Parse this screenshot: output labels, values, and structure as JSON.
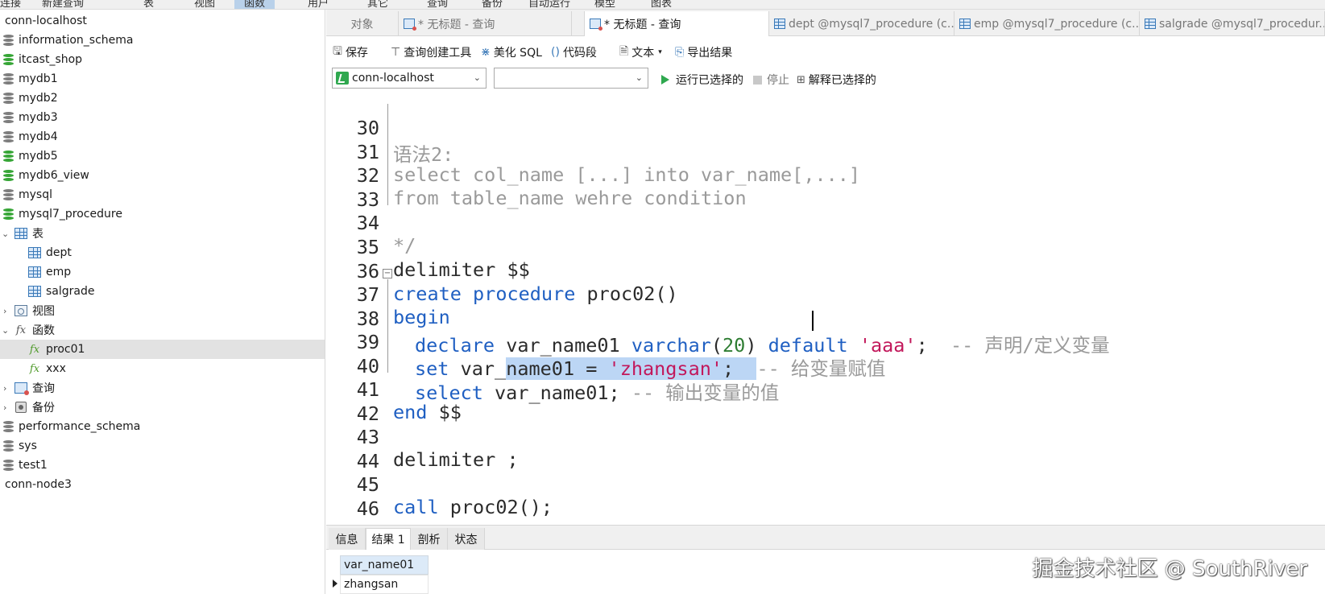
{
  "menu": {
    "items": [
      "连接",
      "新建查询",
      "表",
      "视图",
      "函数",
      "用户",
      "其它",
      "查询",
      "备份",
      "自动运行",
      "模型",
      "图表"
    ],
    "active": "函数"
  },
  "sidebar": {
    "connection": "conn-localhost",
    "databases": {
      "information_schema": "information_schema",
      "itcast_shop": "itcast_shop",
      "mydb1": "mydb1",
      "mydb2": "mydb2",
      "mydb3": "mydb3",
      "mydb4": "mydb4",
      "mydb5": "mydb5",
      "mydb6_view": "mydb6_view",
      "mysql": "mysql",
      "mysql7_procedure": "mysql7_procedure",
      "performance_schema": "performance_schema",
      "sys": "sys",
      "test1": "test1"
    },
    "tables_label": "表",
    "tables": [
      "dept",
      "emp",
      "salgrade"
    ],
    "views_label": "视图",
    "functions_label": "函数",
    "functions": [
      "proc01",
      "xxx"
    ],
    "queries_label": "查询",
    "backups_label": "备份",
    "connection2": "conn-node3"
  },
  "tabs": {
    "objects": "对象",
    "query1": "* 无标题 - 查询",
    "query2": "* 无标题 - 查询",
    "dept": "dept @mysql7_procedure (c...",
    "emp": "emp @mysql7_procedure (c...",
    "salgrade": "salgrade @mysql7_procedur..."
  },
  "toolbar": {
    "save": "保存",
    "query_builder": "查询创建工具",
    "beautify": "美化 SQL",
    "snippet": "代码段",
    "text": "文本",
    "export": "导出结果"
  },
  "toolbar2": {
    "connection_value": "conn-localhost",
    "database_value": "",
    "run_selected": "运行已选择的",
    "stop": "停止",
    "explain_selected": "解释已选择的"
  },
  "editor": {
    "line_numbers": [
      "30",
      "31",
      "32",
      "33",
      "34",
      "35",
      "36",
      "37",
      "38",
      "39",
      "40",
      "41",
      "42",
      "43",
      "44",
      "45",
      "46"
    ],
    "l30": "语法2:",
    "l31": "select col_name [...] into var_name[,...]",
    "l32": "from table_name wehre condition",
    "l34": "*/",
    "l35": "delimiter $$",
    "l36_kw": "create procedure",
    "l36_rest": " proc02()",
    "l37": "begin",
    "l38_kw1": "declare",
    "l38_a": " var_name01 ",
    "l38_kw2": "varchar",
    "l38_b": "(",
    "l38_num": "20",
    "l38_c": ") ",
    "l38_kw3": "default",
    "l38_d": " ",
    "l38_str": "'aaa'",
    "l38_e": ";  ",
    "l38_cmt": "-- 声明/定义变量",
    "l39_kw": "set",
    "l39_a": " var_",
    "l39_sel1": "name01 = ",
    "l39_str": "'zhangsan'",
    "l39_sel2": ";  ",
    "l39_cmt": "-- 给变量赋值",
    "l40_kw": "select",
    "l40_a": " var_name01; ",
    "l40_cmt": "-- 输出变量的值",
    "l41_kw": "end",
    "l41_a": " $$",
    "l43": "delimiter ;",
    "l45_kw": "call",
    "l45_a": " proc02();"
  },
  "results": {
    "tabs": [
      "信息",
      "结果 1",
      "剖析",
      "状态"
    ],
    "active_tab": "结果 1",
    "column": "var_name01",
    "rows": [
      "zhangsan"
    ]
  },
  "watermark": "掘金技术社区 @ SouthRiver"
}
